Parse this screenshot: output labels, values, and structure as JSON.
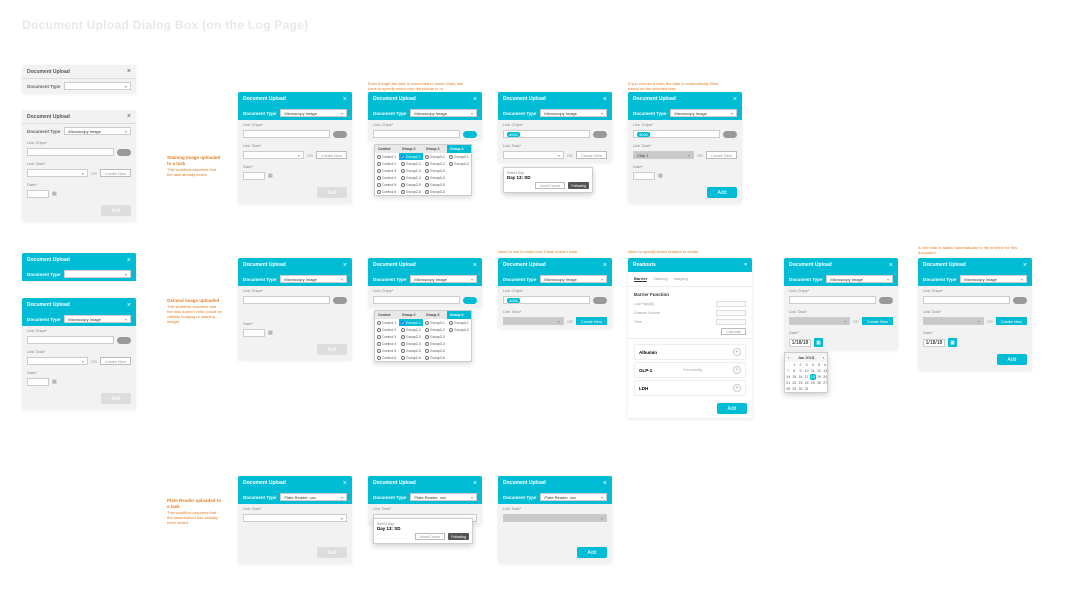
{
  "page_title": "Document Upload Dialog Box (on the Log Page)",
  "dialog_title": "Document Upload",
  "doc_type_label": "Document Type",
  "doc_type_value_microscopy": "Microscopy Image",
  "doc_type_value_plate": "Plate Reader .csv",
  "link_chips_label": "Link Chips*",
  "link_task_label": "Link Task*",
  "date_label": "Date*",
  "or": "OR",
  "create_new": "Create New",
  "add": "Add",
  "close": "×",
  "calendar_icon": "▦",
  "callouts": {
    "staining": {
      "h": "Staining Image uploaded to a task",
      "s": "This workflow assumes that the task already exists"
    },
    "general": {
      "h": "General image uploaded",
      "s": "This workflow assumes that the task doesn't exist (could be viability imaging or staining image)"
    },
    "plate": {
      "h": "Plate Reader uploaded to a task",
      "s": "This workflow assumes that the task/readout has actually been added"
    }
  },
  "annotations": {
    "a1": "Even though the task is connected to some chips, still have to specify which chip the picture is of",
    "a2": "If you choose a task, the date is automatically filled based on the selected task.",
    "a3": "Need to link to chips now if task doesn't exist",
    "a4": "Need to specify which readout to create",
    "a5": "A new task is added automatically to the timeline for this document"
  },
  "chip_dropdown": {
    "columns": [
      "Control",
      "Group 2",
      "Group 3",
      "Group 4"
    ],
    "rows": 6,
    "row_prefix": {
      "control": "Control",
      "other": "Group"
    }
  },
  "task_selected": {
    "chip": "4000",
    "task_short": "Chip 1"
  },
  "date_popup": {
    "line1": "Select Day",
    "line2": "Day 13: SD",
    "buttons": [
      "None/Cancel",
      "Following"
    ]
  },
  "readouts": {
    "title": "Readouts",
    "tabs": [
      "Barrier",
      "Staining",
      "Imaging"
    ],
    "group1": "Barrier Function",
    "fields": [
      "Low Papp(8)",
      "Channel Volume",
      "Time"
    ],
    "list": [
      "Albumin",
      "GLP-1",
      "LDH"
    ],
    "add": "Add",
    "cancel": "Calculate"
  },
  "date_filled": "1/18/18",
  "calendar": {
    "month": "Jan",
    "year": "2018",
    "today": 18,
    "days_in_month": 31,
    "start_weekday": 1
  }
}
